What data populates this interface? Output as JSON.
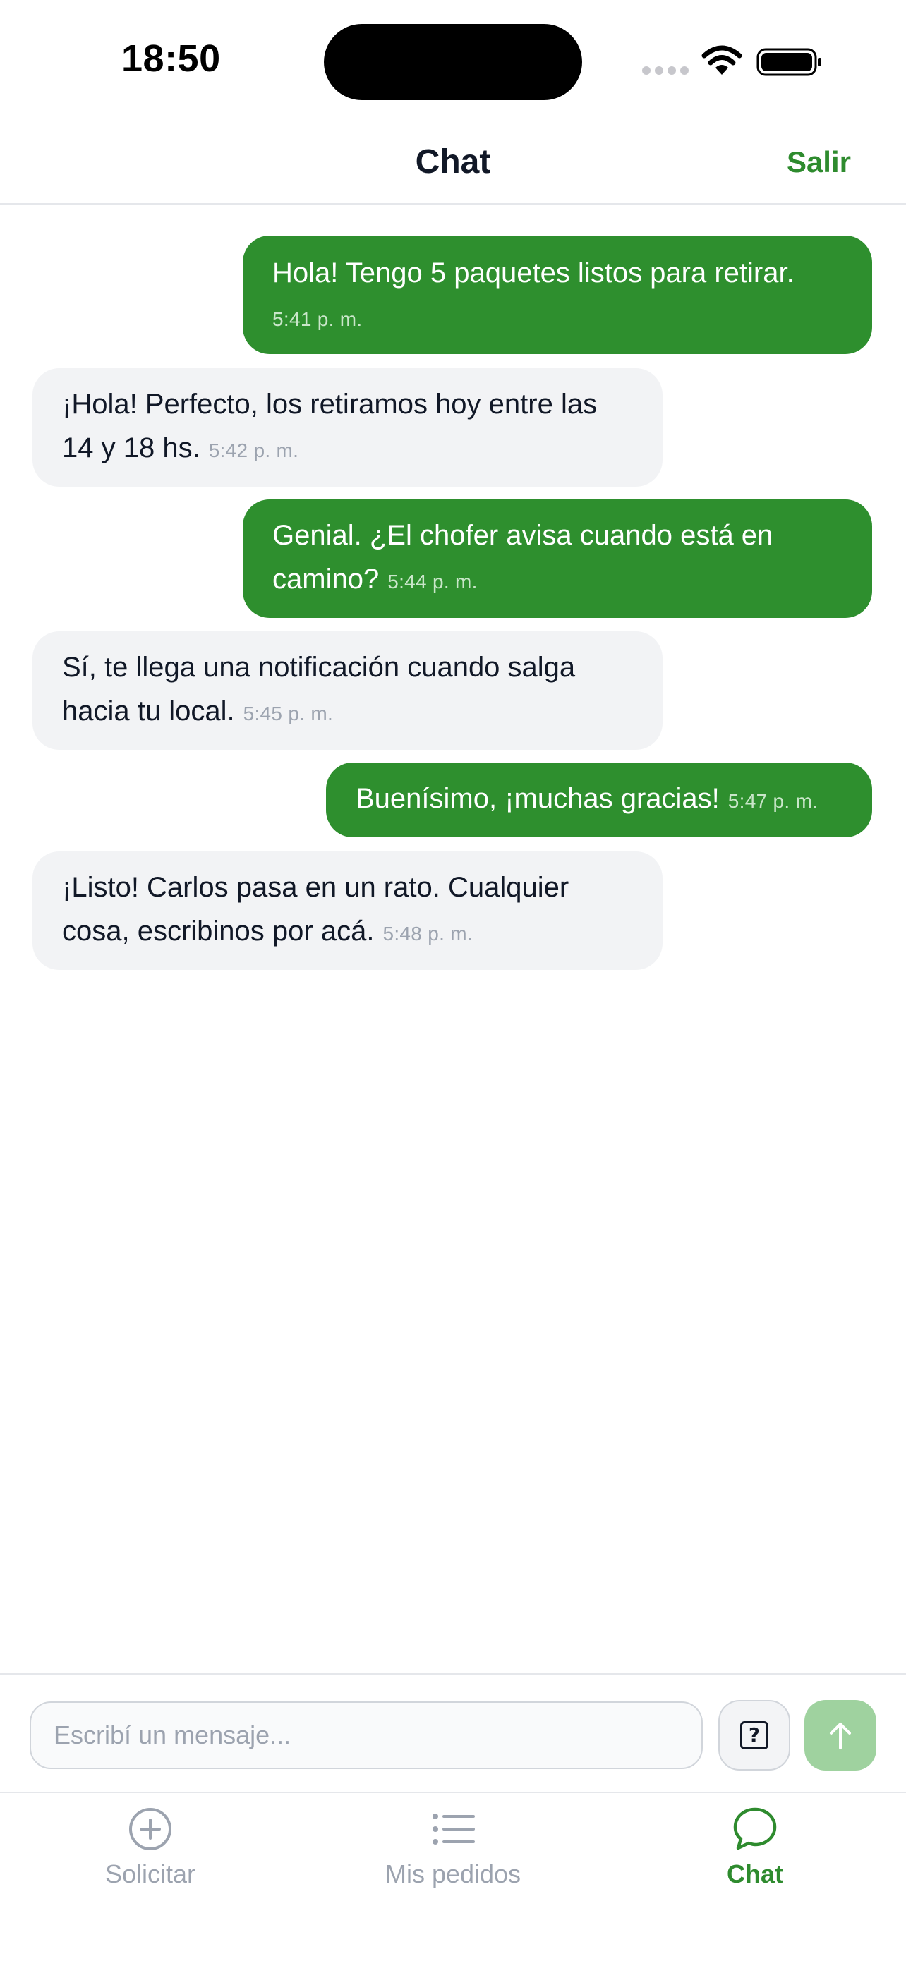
{
  "status_bar": {
    "time": "18:50"
  },
  "header": {
    "title": "Chat",
    "logout_label": "Salir"
  },
  "messages": [
    {
      "direction": "out",
      "text": "Hola! Tengo 5 paquetes listos para retirar.",
      "time": "5:41 p. m."
    },
    {
      "direction": "in",
      "text": "¡Hola! Perfecto, los retiramos hoy entre las 14 y 18 hs.",
      "time": "5:42 p. m."
    },
    {
      "direction": "out",
      "text": "Genial. ¿El chofer avisa cuando está en camino?",
      "time": "5:44 p. m."
    },
    {
      "direction": "in",
      "text": "Sí, te llega una notificación cuando salga hacia tu local.",
      "time": "5:45 p. m."
    },
    {
      "direction": "out",
      "text": "Buenísimo, ¡muchas gracias!",
      "time": "5:47 p. m."
    },
    {
      "direction": "in",
      "text": "¡Listo! Carlos pasa en un rato. Cualquier cosa, escribinos por acá.",
      "time": "5:48 p. m."
    }
  ],
  "composer": {
    "placeholder": "Escribí un mensaje...",
    "value": "",
    "help_glyph": "?"
  },
  "tabbar": {
    "tabs": [
      {
        "label": "Solicitar",
        "icon": "plus-circle-icon",
        "active": false
      },
      {
        "label": "Mis pedidos",
        "icon": "list-icon",
        "active": false
      },
      {
        "label": "Chat",
        "icon": "chat-bubble-icon",
        "active": true
      }
    ]
  },
  "colors": {
    "accent": "#2e8b2e",
    "outgoing_bubble": "#2e8f2e",
    "incoming_bubble": "#f2f3f5",
    "send_disabled": "#9fd29f"
  }
}
